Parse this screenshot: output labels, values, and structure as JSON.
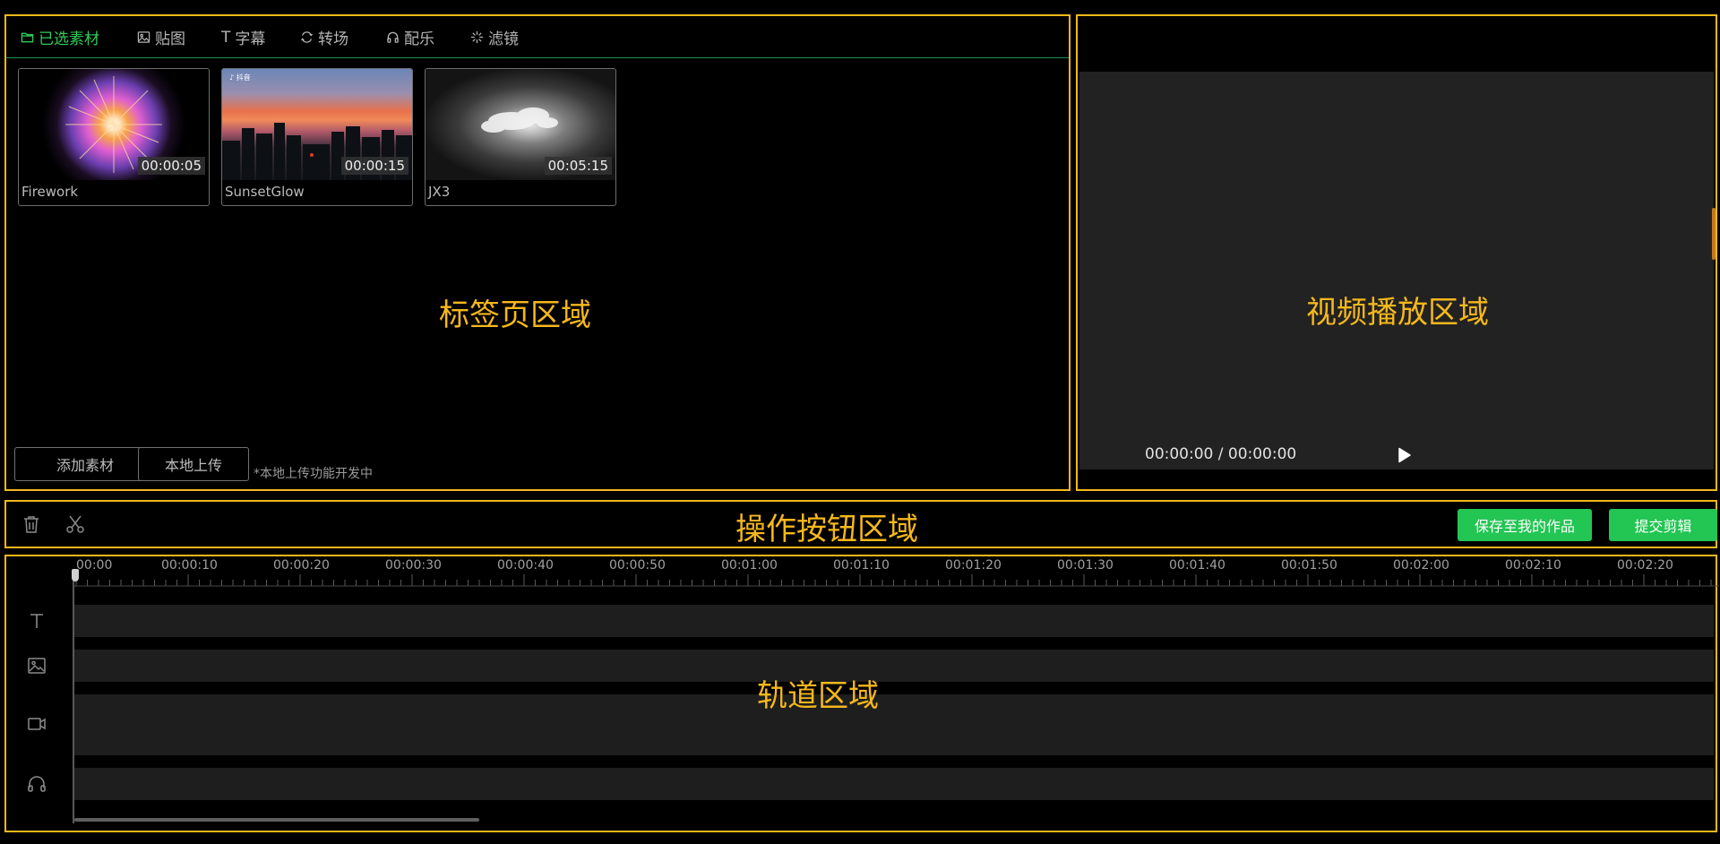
{
  "tabs_panel": {
    "tabs": [
      {
        "label": "已选素材",
        "icon": "folder-icon"
      },
      {
        "label": "贴图",
        "icon": "image-icon"
      },
      {
        "label": "字幕",
        "icon": "text-icon"
      },
      {
        "label": "转场",
        "icon": "transition-icon"
      },
      {
        "label": "配乐",
        "icon": "headphones-icon"
      },
      {
        "label": "滤镜",
        "icon": "filter-icon"
      }
    ],
    "clips": [
      {
        "name": "Firework",
        "duration": "00:00:05"
      },
      {
        "name": "SunsetGlow",
        "duration": "00:00:15"
      },
      {
        "name": "JX3",
        "duration": "00:05:15"
      }
    ],
    "add_button": "添加素材",
    "upload_button": "本地上传",
    "upload_hint": "*本地上传功能开发中",
    "zone_label": "标签页区域"
  },
  "player": {
    "time": "00:00:00 / 00:00:00",
    "zone_label": "视频播放区域"
  },
  "actions": {
    "zone_label": "操作按钮区域",
    "save_button": "保存至我的作品",
    "submit_button": "提交剪辑"
  },
  "tracks": {
    "zone_label": "轨道区域",
    "ruler_labels": [
      "00:00",
      "00:00:10",
      "00:00:20",
      "00:00:30",
      "00:00:40",
      "00:00:50",
      "00:01:00",
      "00:01:10",
      "00:01:20",
      "00:01:30",
      "00:01:40",
      "00:01:50",
      "00:02:00",
      "00:02:10",
      "00:02:20"
    ],
    "track_icons": [
      "text-track-icon",
      "image-track-icon",
      "video-track-icon",
      "audio-track-icon"
    ]
  },
  "colors": {
    "accent": "#2ecc58",
    "zone_border": "#f5b81b",
    "button_green": "#23c553"
  }
}
